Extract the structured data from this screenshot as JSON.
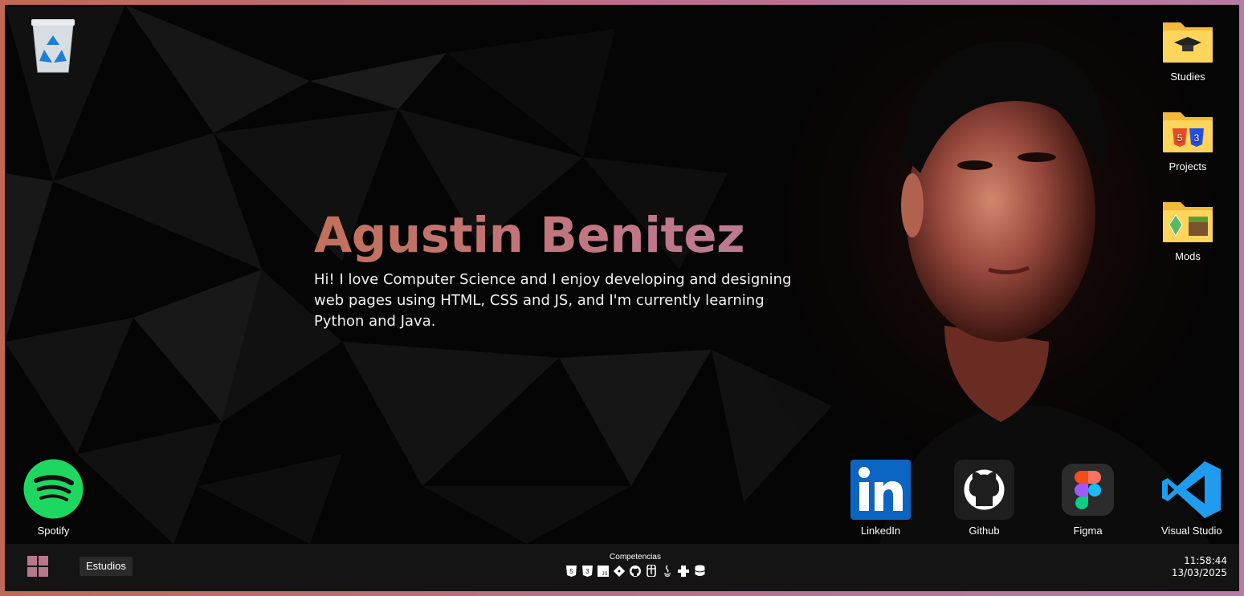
{
  "desktop": {
    "recycle_bin": {
      "icon": "recycle-bin-icon"
    },
    "folders": [
      {
        "label": "Studies",
        "icon": "folder-graduation-cap-icon"
      },
      {
        "label": "Projects",
        "icon": "folder-html-css-icon"
      },
      {
        "label": "Mods",
        "icon": "folder-minecraft-icon"
      }
    ],
    "apps": [
      {
        "label": "Spotify",
        "icon": "spotify-icon"
      },
      {
        "label": "LinkedIn",
        "icon": "linkedin-icon"
      },
      {
        "label": "Github",
        "icon": "github-icon"
      },
      {
        "label": "Figma",
        "icon": "figma-icon"
      },
      {
        "label": "Visual Studio",
        "icon": "vscode-icon"
      }
    ]
  },
  "hero": {
    "name": "Agustin Benitez",
    "bio": "Hi! I love Computer Science and I enjoy developing and designing web pages using HTML, CSS and JS, and I'm currently learning Python and Java."
  },
  "taskbar": {
    "start_icon": "windows-start-icon",
    "open_window": "Estudios",
    "skills_title": "Competencias",
    "skills": [
      "html5-icon",
      "css3-icon",
      "javascript-icon",
      "git-icon",
      "github-icon",
      "figma-icon",
      "java-icon",
      "python-icon",
      "database-icon"
    ],
    "time": "11:58:44",
    "date": "13/03/2025"
  },
  "colors": {
    "accent": "#c17784",
    "frame_start": "#c06a55",
    "frame_end": "#b67aa6",
    "taskbar": "#141414"
  }
}
